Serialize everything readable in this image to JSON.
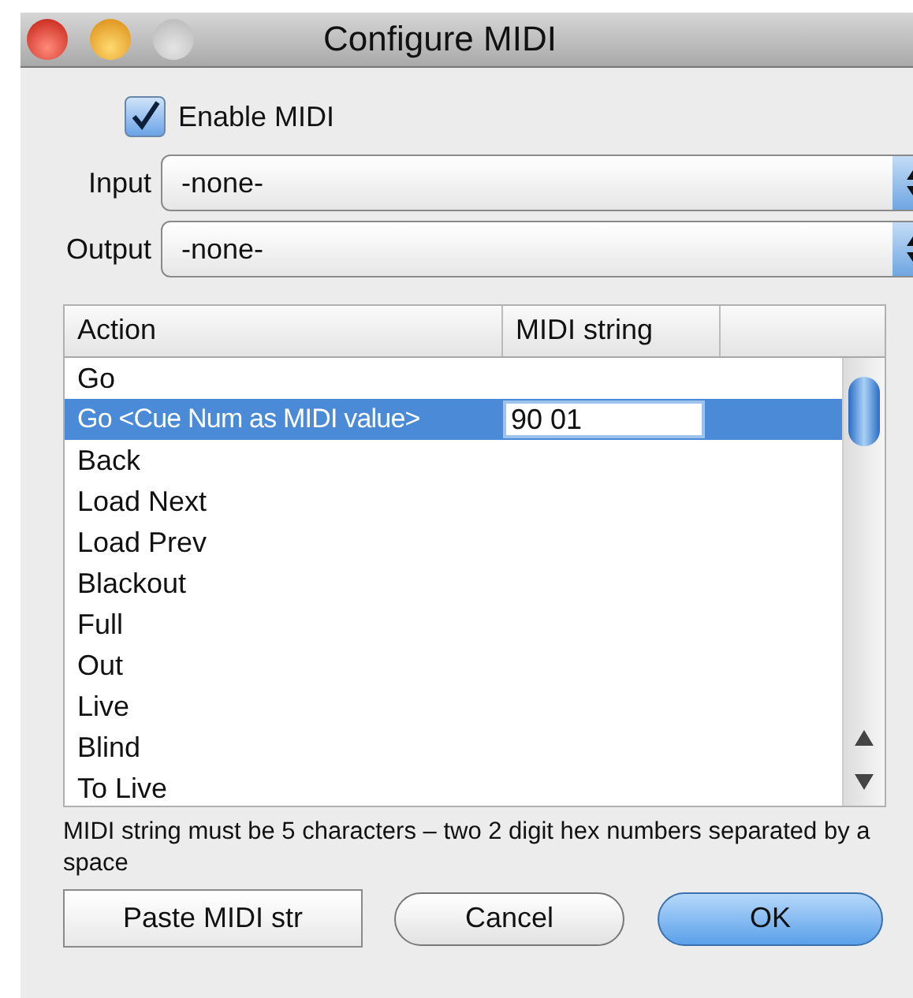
{
  "window": {
    "title": "Configure MIDI"
  },
  "enable_midi": {
    "label": "Enable MIDI",
    "checked": true
  },
  "selects": [
    {
      "label": "Input",
      "value": "-none-"
    },
    {
      "label": "Output",
      "value": "-none-"
    }
  ],
  "table": {
    "columns": [
      "Action",
      "MIDI string"
    ],
    "rows": [
      {
        "action": "Go",
        "selected": false
      },
      {
        "action": "Go <Cue Num as MIDI value>",
        "midi": "90 01",
        "selected": true
      },
      {
        "action": "Back",
        "selected": false
      },
      {
        "action": "Load Next",
        "selected": false
      },
      {
        "action": "Load Prev",
        "selected": false
      },
      {
        "action": "Blackout",
        "selected": false
      },
      {
        "action": "Full",
        "selected": false
      },
      {
        "action": "Out",
        "selected": false
      },
      {
        "action": "Live",
        "selected": false
      },
      {
        "action": "Blind",
        "selected": false
      },
      {
        "action": "To Live",
        "selected": false
      }
    ]
  },
  "hint": "MIDI string must be 5 characters – two 2 digit hex numbers separated by a space",
  "buttons": [
    {
      "label": "Paste MIDI str",
      "kind": "square"
    },
    {
      "label": "Cancel",
      "kind": "push"
    },
    {
      "label": "OK",
      "kind": "default"
    }
  ]
}
